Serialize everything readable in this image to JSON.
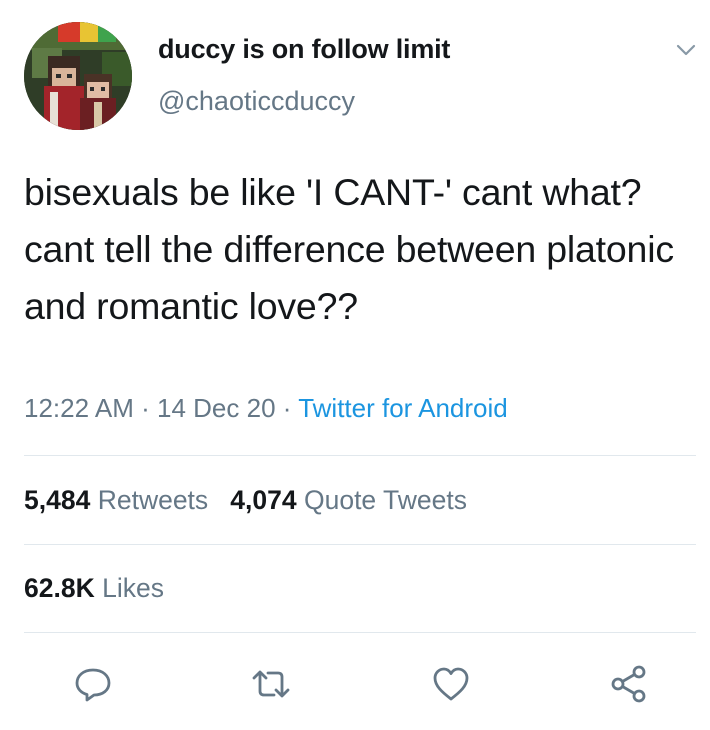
{
  "author": {
    "display_name": "duccy is on follow limit",
    "handle": "@chaoticcduccy",
    "avatar_icon": "avatar-image"
  },
  "tweet": {
    "text": "bisexuals be like 'I CANT-' cant what? cant tell the difference between platonic and romantic love??",
    "time": "12:22 AM",
    "date": "14 Dec 20",
    "separator": "·",
    "source": "Twitter for Android"
  },
  "stats": {
    "retweets_count": "5,484",
    "retweets_label": "Retweets",
    "quotes_count": "4,074",
    "quotes_label": "Quote Tweets",
    "likes_count": "62.8K",
    "likes_label": "Likes"
  },
  "icons": {
    "more": "chevron-down-icon",
    "reply": "reply-icon",
    "retweet": "retweet-icon",
    "like": "heart-icon",
    "share": "share-icon"
  },
  "colors": {
    "text": "#14171a",
    "secondary": "#657786",
    "link": "#1b95e0",
    "divider": "#e1e8ed"
  }
}
